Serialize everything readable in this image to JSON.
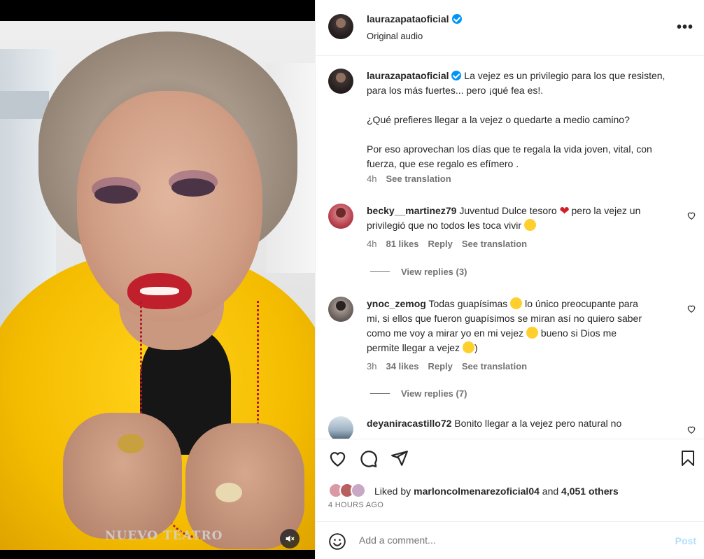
{
  "post": {
    "username": "laurazapataoficial",
    "audio": "Original audio",
    "more_label": "•••",
    "video_overlay_text": "NUEVO TEATRO"
  },
  "caption": {
    "username": "laurazapataoficial",
    "p1": "La vejez es un privilegio para los que resisten, para los más fuertes... pero ¡qué fea es!.",
    "p2": "¿Qué prefieres llegar a la vejez o quedarte a medio camino?",
    "p3": "Por eso aprovechan los días que te regala la vida joven, vital, con fuerza, que ese regalo es efímero .",
    "time": "4h",
    "translate": "See translation"
  },
  "comments": [
    {
      "username": "becky__martinez79",
      "text_a": "Juventud Dulce tesoro ",
      "text_b": "pero la vejez un privilegió que no todos les toca vivir ",
      "time": "4h",
      "likes": "81 likes",
      "reply": "Reply",
      "translate": "See translation",
      "replies": "View replies (3)"
    },
    {
      "username": "ynoc_zemog",
      "text_a": "Todas guapísimas ",
      "text_b": " lo único preocupante para mi, si ellos que fueron guapísimos se miran así no quiero saber como me voy a mirar yo en mi vejez ",
      "text_c": " bueno si Dios me permite llegar a vejez ",
      "text_d": ")",
      "time": "3h",
      "likes": "34 likes",
      "reply": "Reply",
      "translate": "See translation",
      "replies": "View replies (7)"
    },
    {
      "username": "deyaniracastillo72",
      "text_a": "Bonito llegar a la vejez pero natural no"
    }
  ],
  "likes_line": {
    "prefix": "Liked by ",
    "user": "marloncolmenarezoficial04",
    "mid": " and ",
    "others": "4,051 others"
  },
  "time_ago": "4 HOURS AGO",
  "add_comment": {
    "placeholder": "Add a comment...",
    "post_label": "Post"
  },
  "colors": {
    "accent": "#0095f6",
    "muted": "#737373",
    "post_disabled": "#b2dffc"
  }
}
